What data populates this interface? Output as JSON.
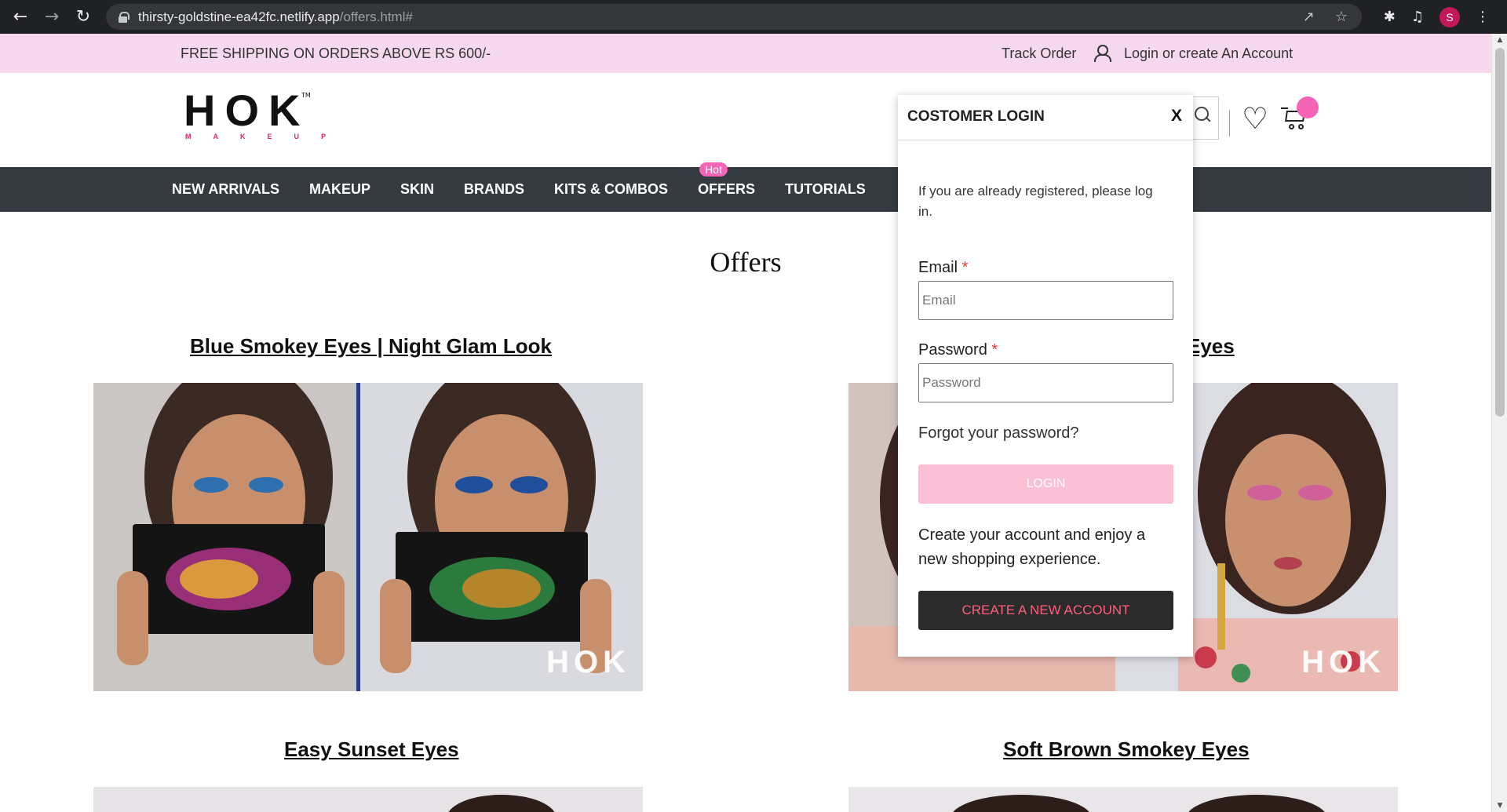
{
  "browser": {
    "url_host": "thirsty-goldstine-ea42fc.netlify.app",
    "url_path": "/offers.html#",
    "profile_initial": "S"
  },
  "topbar": {
    "shipping_text": "FREE SHIPPING ON ORDERS ABOVE RS 600/-",
    "track_order": "Track Order",
    "login_link": "Login or create An Account"
  },
  "header": {
    "logo_text": "HOK",
    "logo_sub": "MAKEUP",
    "logo_tm": "TM"
  },
  "nav": {
    "items": [
      {
        "label": "NEW ARRIVALS"
      },
      {
        "label": "MAKEUP"
      },
      {
        "label": "SKIN"
      },
      {
        "label": "BRANDS"
      },
      {
        "label": "KITS & COMBOS"
      },
      {
        "label": "OFFERS",
        "badge": "Hot"
      },
      {
        "label": "TUTORIALS"
      }
    ]
  },
  "page": {
    "title": "Offers",
    "cards": [
      {
        "title": "Blue Smokey Eyes | Night Glam Look",
        "watermark": "HOK"
      },
      {
        "title": "Eyes",
        "watermark": "HOK"
      },
      {
        "title": "Easy Sunset Eyes"
      },
      {
        "title": "Soft Brown Smokey Eyes"
      }
    ]
  },
  "login_modal": {
    "title": "COSTOMER LOGIN",
    "close": "X",
    "intro": "If you are already registered, please log in.",
    "email_label": "Email",
    "email_placeholder": "Email",
    "password_label": "Password",
    "password_placeholder": "Password",
    "required_mark": "*",
    "forgot": "Forgot your password?",
    "login_button": "LOGIN",
    "create_text": "Create your account and enjoy a new shopping experience.",
    "create_button": "CREATE A NEW ACCOUNT"
  },
  "colors": {
    "topbar_bg": "#f6d9ef",
    "nav_bg": "#343a40",
    "accent_pink": "#f564b6",
    "login_btn": "#fcc0d6",
    "create_btn_text": "#ff5e7a"
  },
  "icons": [
    "back-icon",
    "forward-icon",
    "reload-icon",
    "lock-icon",
    "share-icon",
    "star-icon",
    "extensions-icon",
    "media-icon",
    "kebab-icon",
    "user-icon",
    "search-icon",
    "heart-icon",
    "cart-icon"
  ]
}
